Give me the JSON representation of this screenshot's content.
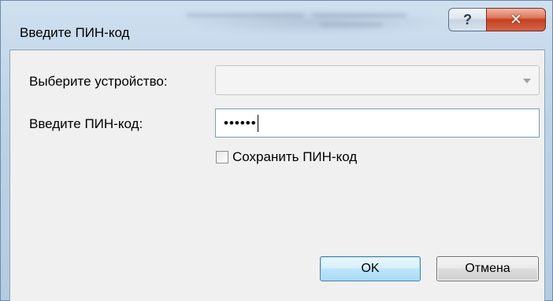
{
  "window": {
    "title": "Введите ПИН-код",
    "help_glyph": "?",
    "close_glyph": "✕"
  },
  "form": {
    "device_label": "Выберите устройство:",
    "device_value": "",
    "pin_label": "Введите ПИН-код:",
    "pin_value": "••••••",
    "save_pin_label": "Сохранить ПИН-код",
    "save_pin_checked": false
  },
  "buttons": {
    "ok_label": "OK",
    "cancel_label": "Отмена"
  },
  "icons": {
    "help": "help-icon",
    "close": "close-icon",
    "dropdown": "chevron-down-icon"
  },
  "colors": {
    "close_button": "#c6401f",
    "ok_border": "#3c7fb1",
    "input_border": "#7a9bbd"
  }
}
